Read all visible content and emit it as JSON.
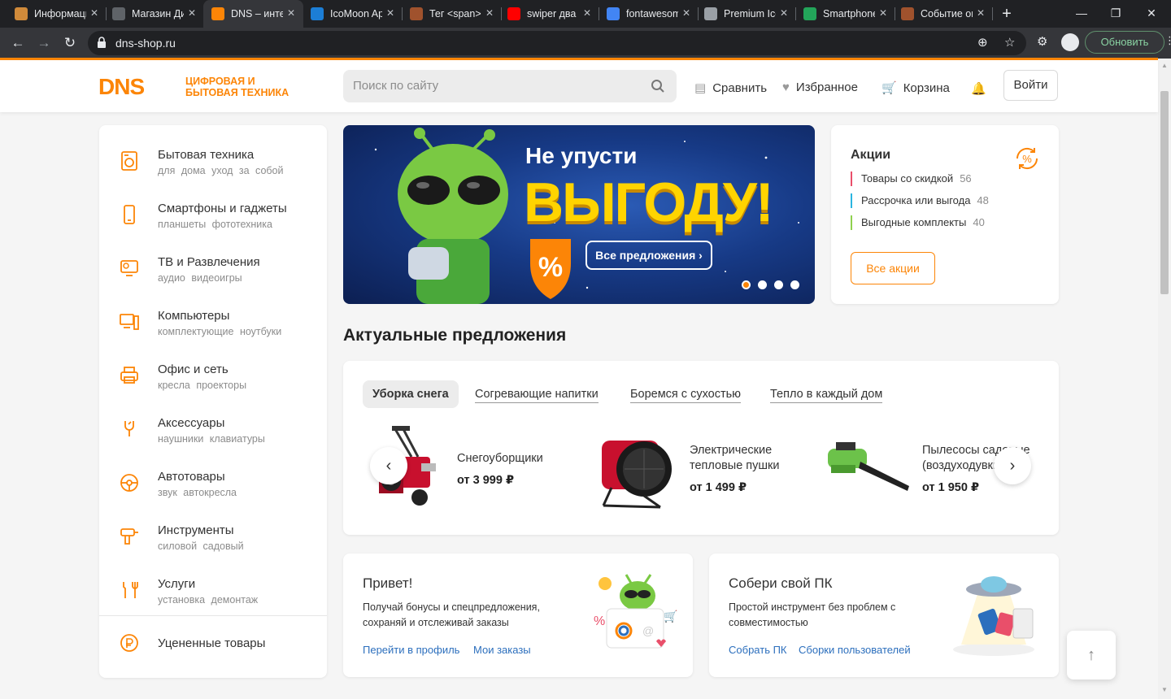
{
  "browser": {
    "tabs": [
      {
        "label": "Информационный",
        "favicon_color": "#d08a3a"
      },
      {
        "label": "Магазин Дизайн",
        "favicon_color": "#5f6368"
      },
      {
        "label": "DNS – интернет",
        "favicon_color": "#fc8507",
        "favicon_text": "DNS"
      },
      {
        "label": "IcoMoon App",
        "favicon_color": "#1c7ed6"
      },
      {
        "label": "Тег <span>",
        "favicon_color": "#a0522d"
      },
      {
        "label": "swiper два",
        "favicon_color": "#ff0000"
      },
      {
        "label": "fontawesome",
        "favicon_color": "#4285f4"
      },
      {
        "label": "Premium Icons",
        "favicon_color": "#9aa0a6"
      },
      {
        "label": "Smartphone",
        "favicon_color": "#23a55a"
      },
      {
        "label": "Событие onclick",
        "favicon_color": "#a0522d"
      }
    ],
    "active_tab": 2,
    "url": "dns-shop.ru",
    "update_label": "Обновить"
  },
  "header": {
    "logo_text": "DNS",
    "logo_tagline_1": "ЦИФРОВАЯ И",
    "logo_tagline_2": "БЫТОВАЯ ТЕХНИКА",
    "search_placeholder": "Поиск по сайту",
    "compare_label": "Сравнить",
    "favorites_label": "Избранное",
    "cart_label": "Корзина",
    "login_label": "Войти"
  },
  "catalog": [
    {
      "title": "Бытовая техника",
      "sub": "для дома  уход за собой",
      "icon": "washing-machine-icon"
    },
    {
      "title": "Смартфоны и гаджеты",
      "sub": "планшеты  фототехника",
      "icon": "smartphone-icon"
    },
    {
      "title": "ТВ и Развлечения",
      "sub": "аудио  видеоигры",
      "icon": "tv-icon"
    },
    {
      "title": "Компьютеры",
      "sub": "комплектующие  ноутбуки",
      "icon": "computer-icon"
    },
    {
      "title": "Офис и сеть",
      "sub": "кресла  проекторы",
      "icon": "printer-icon"
    },
    {
      "title": "Аксессуары",
      "sub": "наушники  клавиатуры",
      "icon": "cable-icon"
    },
    {
      "title": "Автотовары",
      "sub": "звук  автокресла",
      "icon": "steering-wheel-icon"
    },
    {
      "title": "Инструменты",
      "sub": "силовой  садовый",
      "icon": "drill-icon"
    },
    {
      "title": "Услуги",
      "sub": "установка  демонтаж",
      "icon": "wrench-icon"
    },
    {
      "title": "Уцененные товары",
      "sub": "",
      "icon": "discount-ruble-icon"
    }
  ],
  "banner": {
    "line1": "Не упусти",
    "line2": "ВЫГОДУ!",
    "button": "Все предложения",
    "slides": 4,
    "active_slide": 0
  },
  "promo": {
    "title": "Акции",
    "items": [
      {
        "label": "Товары со скидкой",
        "count": "56",
        "color": "#e94f6a"
      },
      {
        "label": "Рассрочка или выгода",
        "count": "48",
        "color": "#2bb5e0"
      },
      {
        "label": "Выгодные комплекты",
        "count": "40",
        "color": "#8fd14f"
      }
    ],
    "button": "Все акции"
  },
  "offers": {
    "title": "Актуальные предложения",
    "tabs": [
      "Уборка снега",
      "Согревающие напитки",
      "Боремся с сухостью",
      "Тепло в каждый дом"
    ],
    "active_tab": 0,
    "products": [
      {
        "name_1": "Снегоуборщики",
        "name_2": "",
        "price": "от 3 999 ₽"
      },
      {
        "name_1": "Электрические",
        "name_2": "тепловые пушки",
        "price": "от 1 499 ₽"
      },
      {
        "name_1": "Пылесосы садовые",
        "name_2": "(воздуходувки)",
        "price": "от 1 950 ₽"
      }
    ]
  },
  "cards": {
    "hello": {
      "title": "Привет!",
      "text": "Получай бонусы и спецпредложения, сохраняй и отслеживай заказы",
      "link1": "Перейти в профиль",
      "link2": "Мои заказы"
    },
    "pc": {
      "title": "Собери свой ПК",
      "text": "Простой инструмент без проблем с совместимостью",
      "link1": "Собрать ПК",
      "link2": "Сборки пользователей"
    }
  },
  "colors": {
    "accent": "#fc8507",
    "link": "#2c6fbd"
  }
}
